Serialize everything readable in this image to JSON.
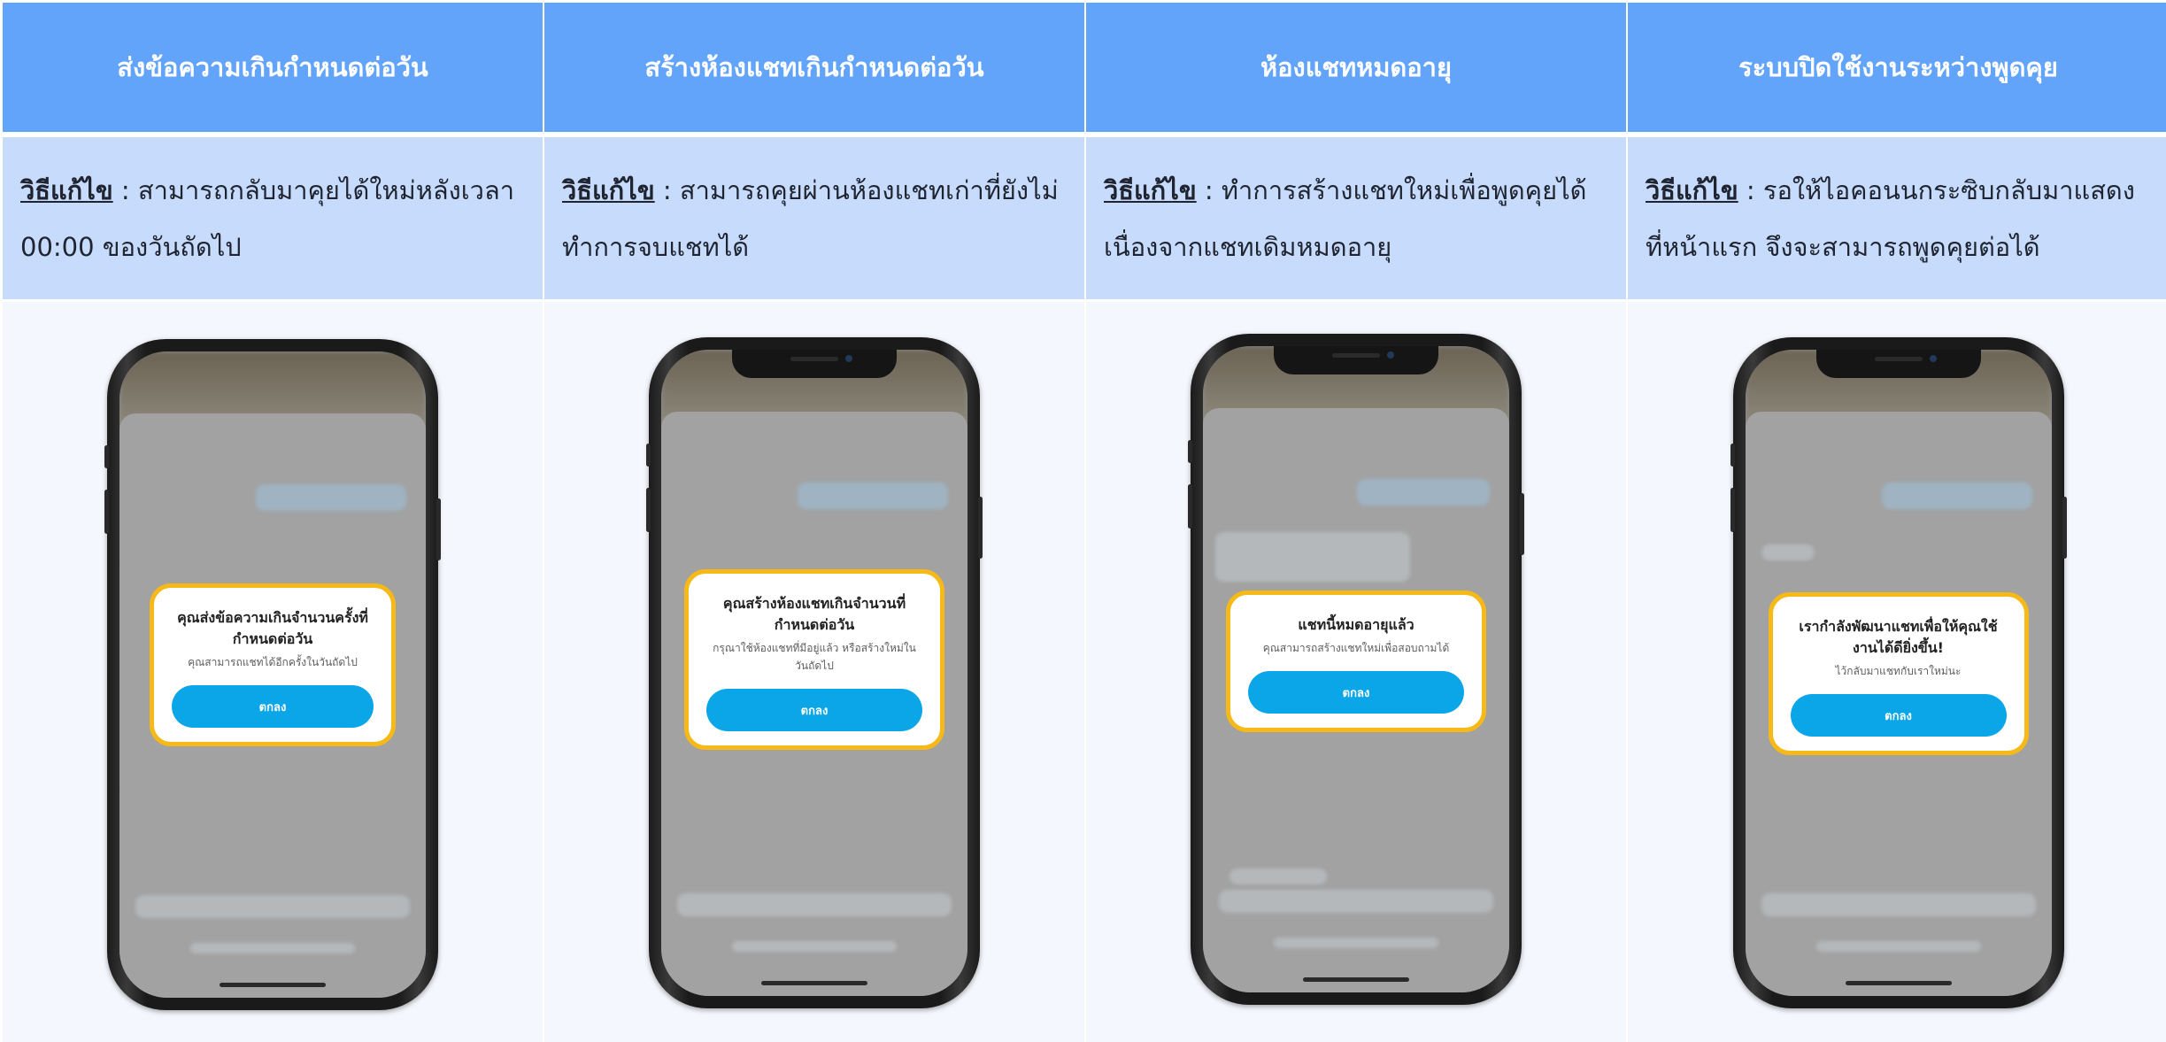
{
  "columns": [
    {
      "header": "ส่งข้อความเกินกำหนดต่อวัน",
      "solution_label": "วิธีแก้ไข",
      "solution_text": " : สามารถกลับมาคุยได้ใหม่หลังเวลา 00:00 ของวันถัดไป",
      "dialog": {
        "title": "คุณส่งข้อความเกินจำนวนครั้งที่กำหนดต่อวัน",
        "message": "คุณสามารถแชทได้อีกครั้งในวันถัดไป",
        "button": "ตกลง"
      }
    },
    {
      "header": "สร้างห้องแชทเกินกำหนดต่อวัน",
      "solution_label": "วิธีแก้ไข",
      "solution_text": " : สามารถคุยผ่านห้องแชทเก่าที่ยังไม่ทำการจบแชทได้",
      "dialog": {
        "title": "คุณสร้างห้องแชทเกินจำนวนที่กำหนดต่อวัน",
        "message": "กรุณาใช้ห้องแชทที่มีอยู่แล้ว หรือสร้างใหม่ในวันถัดไป",
        "button": "ตกลง"
      }
    },
    {
      "header": "ห้องแชทหมดอายุ",
      "solution_label": "วิธีแก้ไข",
      "solution_text": " : ทำการสร้างแชทใหม่เพื่อพูดคุยได้ เนื่องจากแชทเดิมหมดอายุ",
      "dialog": {
        "title": "แชทนี้หมดอายุแล้ว",
        "message": "คุณสามารถสร้างแชทใหม่เพื่อสอบถามได้",
        "button": "ตกลง"
      }
    },
    {
      "header": "ระบบปิดใช้งานระหว่างพูดคุย",
      "solution_label": "วิธีแก้ไข",
      "solution_text": " : รอให้ไอคอนนกระซิบกลับมาแสดงที่หน้าแรก จึงจะสามารถพูดคุยต่อได้",
      "dialog": {
        "title": "เรากำลังพัฒนาแชทเพื่อให้คุณใช้งานได้ดียิ่งขึ้น!",
        "message": "ไว้กลับมาแชทกับเราใหม่นะ",
        "button": "ตกลง"
      }
    }
  ],
  "colors": {
    "header_bg": "#63a4fb",
    "solution_bg": "#c7dcfd",
    "dialog_border": "#f6b917",
    "button_bg": "#0aa6e8"
  }
}
